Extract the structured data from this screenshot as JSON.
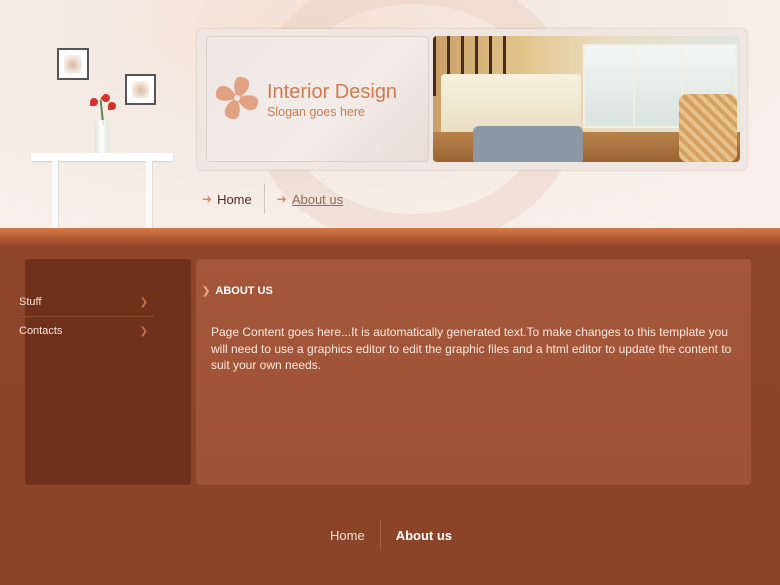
{
  "brand": {
    "title": "Interior Design",
    "slogan": "Slogan goes here",
    "accent_color": "#cf7b52",
    "icon": "pinwheel-logo-icon"
  },
  "top_nav": {
    "items": [
      {
        "label": "Home",
        "icon": "arrow-right-icon"
      },
      {
        "label": "About us",
        "icon": "arrow-right-icon"
      }
    ]
  },
  "sidebar": {
    "items": [
      {
        "label": "Stuff",
        "icon": "chevron-right-icon"
      },
      {
        "label": "Contacts",
        "icon": "chevron-right-icon"
      }
    ]
  },
  "main": {
    "title": "ABOUT US",
    "body": "Page Content goes here...It is automatically generated text.To make changes to this template you will need to use a graphics editor to edit the graphic files and a html editor to update the content to suit your own needs."
  },
  "footer": {
    "links": [
      {
        "label": "Home"
      },
      {
        "label": "About us"
      }
    ]
  },
  "colors": {
    "background": "#8a4428",
    "sidebar": "#6f301c",
    "content_panel": "#a4573a"
  }
}
